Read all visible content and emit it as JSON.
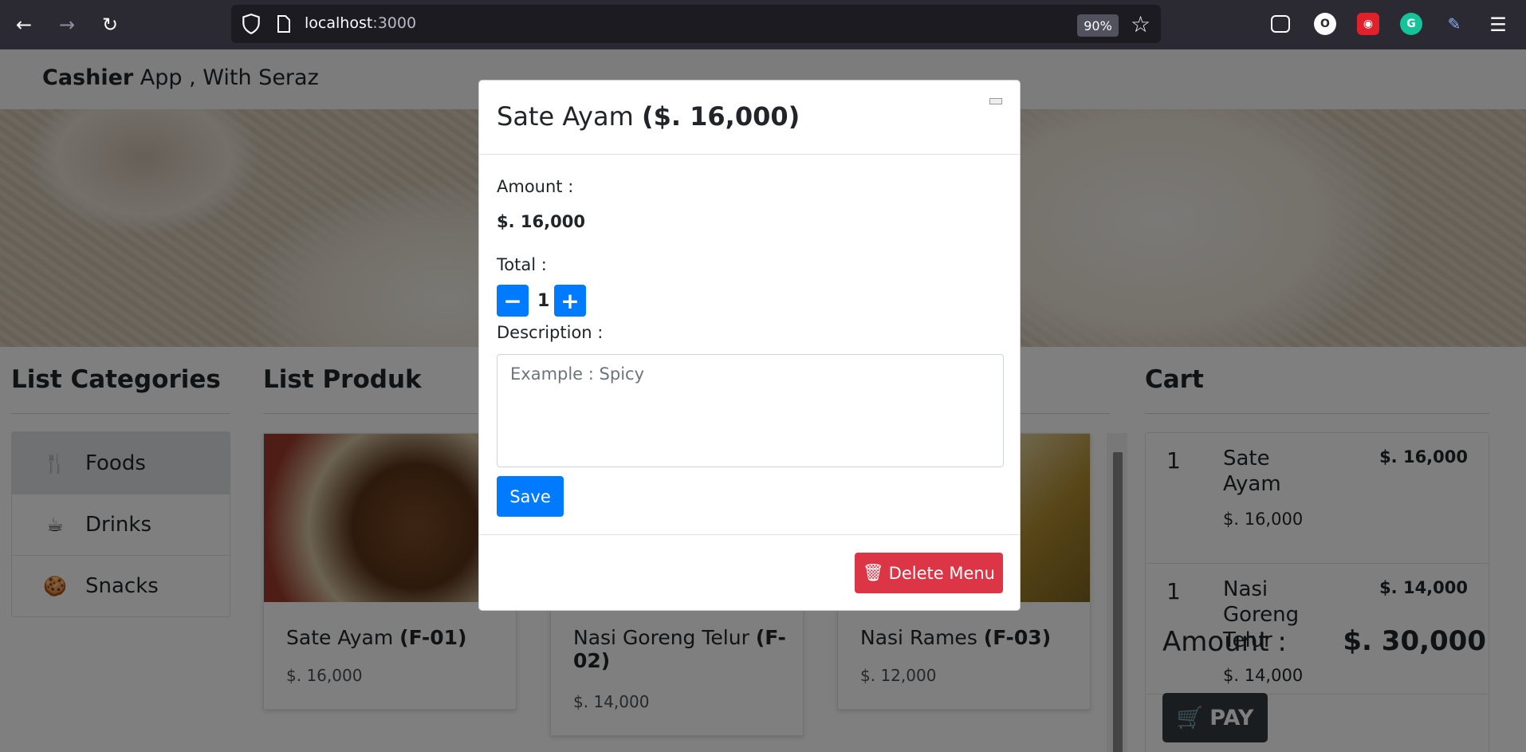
{
  "browser": {
    "url_host": "localhost",
    "url_port": ":3000",
    "zoom": "90%",
    "extensions": [
      "pocket-icon",
      "o-extension-icon",
      "lock-extension-icon",
      "grammarly-icon",
      "eyedropper-icon"
    ]
  },
  "navbar": {
    "brand_bold": "Cashier",
    "brand_rest": " App , With Seraz"
  },
  "categories": {
    "heading": "List Categories",
    "items": [
      {
        "label": "Foods",
        "icon": "utensils-icon"
      },
      {
        "label": "Drinks",
        "icon": "coffee-icon"
      },
      {
        "label": "Snacks",
        "icon": "cookie-icon"
      }
    ]
  },
  "products": {
    "heading": "List Produk",
    "items": [
      {
        "name": "Sate Ayam",
        "code": "(F-01)",
        "price": "$. 16,000"
      },
      {
        "name": "Nasi Goreng Telur",
        "code": "(F-02)",
        "price": "$. 14,000"
      },
      {
        "name": "Nasi Rames",
        "code": "(F-03)",
        "price": "$. 12,000"
      }
    ]
  },
  "cart": {
    "heading": "Cart",
    "items": [
      {
        "qty": "1",
        "name": "Sate Ayam",
        "unit_price": "$. 16,000",
        "subtotal": "$. 16,000"
      },
      {
        "qty": "1",
        "name": "Nasi Goreng Telur",
        "unit_price": "$. 14,000",
        "subtotal": "$. 14,000"
      }
    ],
    "amount_label": "Amount :",
    "amount_value": "$. 30,000",
    "pay_label": "PAY"
  },
  "modal": {
    "title_name": "Sate Ayam ",
    "title_price": "($. 16,000)",
    "amount_label": "Amount :",
    "amount_value": "$. 16,000",
    "total_label": "Total :",
    "quantity": "1",
    "description_label": "Description :",
    "description_placeholder": "Example : Spicy",
    "save_label": "Save",
    "delete_label": "Delete Menu"
  },
  "colors": {
    "primary": "#007bff",
    "danger": "#dc3545",
    "dark": "#343a40"
  }
}
